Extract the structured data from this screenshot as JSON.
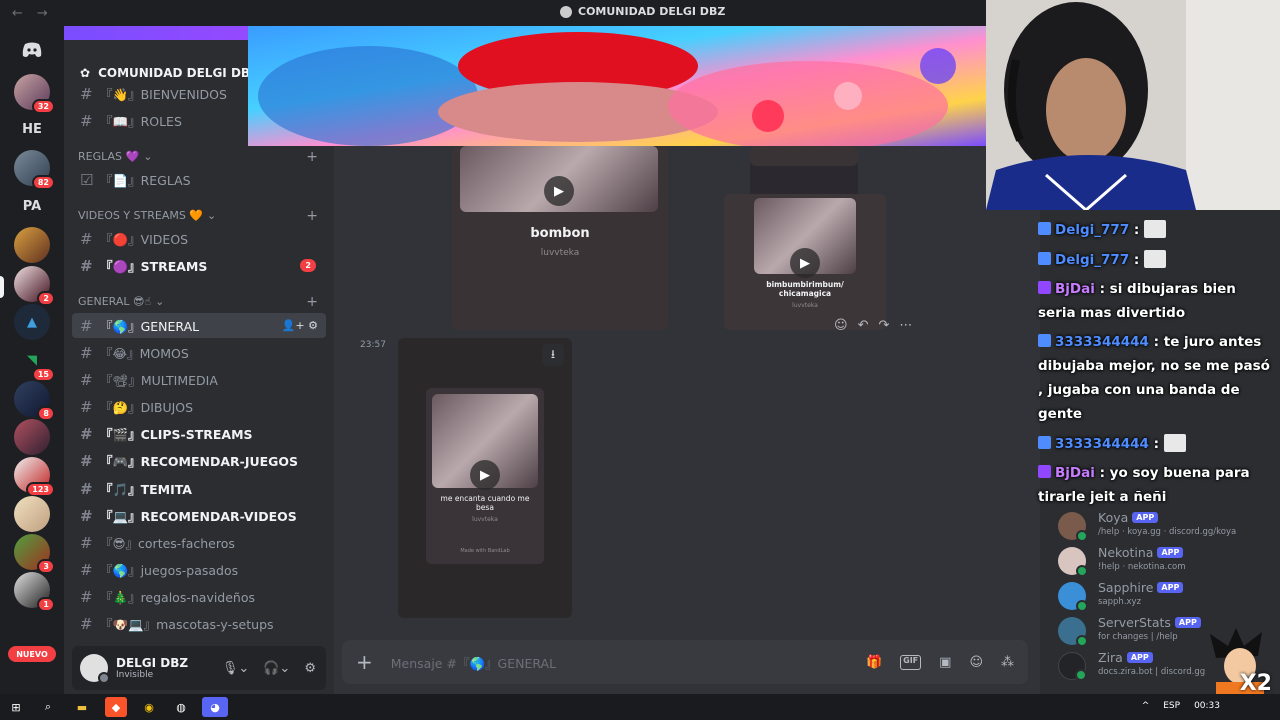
{
  "window": {
    "title": "COMUNIDAD DELGI DBZ",
    "back": "←",
    "forward": "→"
  },
  "servers": [
    {
      "label": "",
      "badge": ""
    },
    {
      "label": "",
      "badge": "32"
    },
    {
      "label": "HE",
      "badge": ""
    },
    {
      "label": "",
      "badge": "82"
    },
    {
      "label": "PA",
      "badge": ""
    },
    {
      "label": "",
      "badge": ""
    },
    {
      "label": "",
      "badge": "2"
    },
    {
      "label": "",
      "badge": ""
    },
    {
      "label": "",
      "badge": "15"
    },
    {
      "label": "",
      "badge": "8"
    },
    {
      "label": "",
      "badge": ""
    },
    {
      "label": "",
      "badge": "123"
    },
    {
      "label": "",
      "badge": ""
    },
    {
      "label": "",
      "badge": "3"
    },
    {
      "label": "",
      "badge": "1"
    }
  ],
  "nuevo_label": "NUEVO",
  "guild": {
    "name": "COMUNIDAD DELGI DBZ"
  },
  "channels_top": [
    {
      "name": "『👋』BIENVENIDOS"
    },
    {
      "name": "『📖』ROLES"
    }
  ],
  "category_reglas": {
    "name": "REGLAS 💜",
    "channel": "『📄』REGLAS"
  },
  "category_videos": {
    "name": "VIDEOS Y STREAMS 🧡",
    "channels": [
      {
        "name": "『🔴』VIDEOS",
        "mention": ""
      },
      {
        "name": "『🟣』STREAMS",
        "mention": "2"
      }
    ]
  },
  "category_general": {
    "name": "GENERAL 😎☝",
    "channels": [
      {
        "name": "『🌎』GENERAL"
      },
      {
        "name": "『😂』MOMOS"
      },
      {
        "name": "『📽』MULTIMEDIA"
      },
      {
        "name": "『🤔』DIBUJOS"
      },
      {
        "name": "『🎬』CLIPS-STREAMS"
      },
      {
        "name": "『🎮』RECOMENDAR-JUEGOS"
      },
      {
        "name": "『🎵』TEMITA"
      },
      {
        "name": "『💻』RECOMENDAR-VIDEOS"
      },
      {
        "name": "『😎』cortes-facheros"
      },
      {
        "name": "『🌎』juegos-pasados"
      },
      {
        "name": "『🎄』regalos-navideños"
      },
      {
        "name": "『🐶💻』mascotas-y-setups"
      }
    ]
  },
  "user": {
    "name": "DELGI DBZ",
    "status": "Invisible"
  },
  "videos": {
    "v1": {
      "title": "bombon",
      "sub": "luvvteka"
    },
    "v2": {
      "title": "bimbumbirimbum/ chicamagica",
      "sub": "luvvteka"
    },
    "v3": {
      "title": "me encanta cuando me besa",
      "sub": "luvvteka",
      "brand": "Made with BandLab"
    },
    "timestamp": "23:57"
  },
  "composer": {
    "placeholder": "Mensaje #『🌎』GENERAL"
  },
  "members": [
    {
      "name": "Koya",
      "status": "/help · koya.gg · discord.gg/koya",
      "color": "#7a5a4a"
    },
    {
      "name": "Nekotina",
      "status": "!help · nekotina.com",
      "color": "#d9c5c0"
    },
    {
      "name": "Sapphire",
      "status": "sapph.xyz",
      "color": "#3b8fd6"
    },
    {
      "name": "ServerStats",
      "status": "for changes | /help",
      "color": "#3a6f8f"
    },
    {
      "name": "Zira",
      "status": "docs.zira.bot | discord.gg",
      "color": "#222428"
    }
  ],
  "app_tag": "APP",
  "stream_chat": [
    {
      "user": "Delgi_777",
      "text": " :"
    },
    {
      "user": "Delgi_777",
      "text": " :"
    },
    {
      "user": "BjDai",
      "text": " : si dibujaras bien seria mas divertido"
    },
    {
      "user": "3333344444",
      "text": " : te juro antes dibujaba mejor, no se me pasó , jugaba con una banda de gente"
    },
    {
      "user": "3333344444",
      "text": " :"
    },
    {
      "user": "BjDai",
      "text": " : yo soy buena para tirarle jeit a ñeñi"
    }
  ],
  "tray": {
    "lang": "ESP",
    "time": "00:33"
  },
  "overlay_text": "X2",
  "colors": {
    "blurple": "#5865f2",
    "red": "#f23f43",
    "sidebar": "#2b2d31",
    "chat": "#313338"
  }
}
